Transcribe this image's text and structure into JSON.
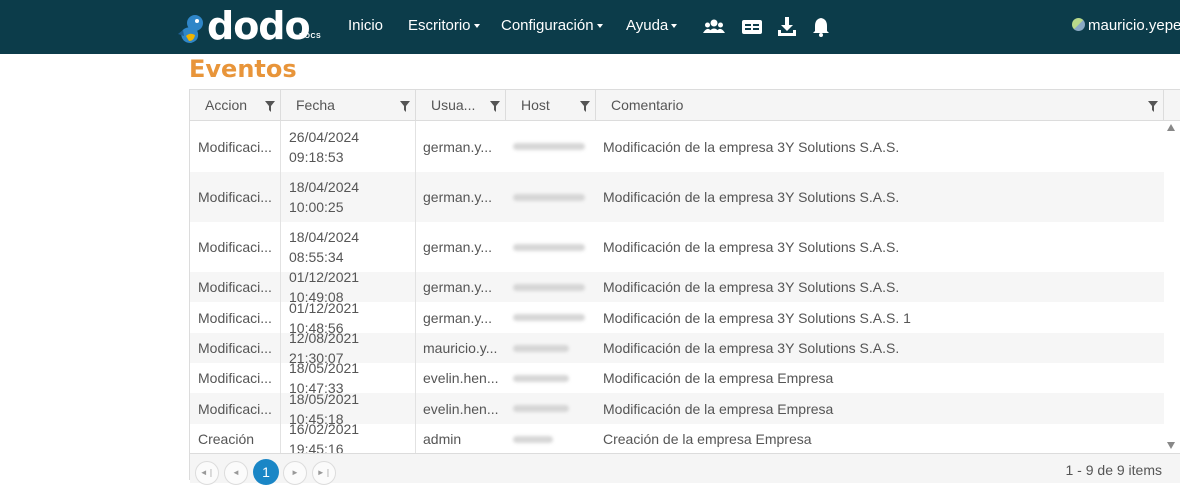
{
  "header": {
    "logo_text": "dodo",
    "logo_sub": "DOCS",
    "nav": [
      {
        "label": "Inicio"
      },
      {
        "label": "Escritorio"
      },
      {
        "label": "Configuración"
      },
      {
        "label": "Ayuda"
      }
    ],
    "icons": [
      "users-icon",
      "id-card-icon",
      "download-icon",
      "bell-icon"
    ],
    "user": "mauricio.yepe",
    "bar_color": "#0c3c4a"
  },
  "page": {
    "title": "Eventos",
    "title_color": "#e8953a"
  },
  "grid": {
    "columns": [
      "Accion",
      "Fecha",
      "Usua...",
      "Host",
      "Comentario"
    ],
    "rows": [
      {
        "accion": "Modificaci...",
        "fecha": "26/04/2024 09:18:53",
        "usuario": "german.y...",
        "comentario": "Modificación de la empresa 3Y Solutions S.A.S."
      },
      {
        "accion": "Modificaci...",
        "fecha": "18/04/2024 10:00:25",
        "usuario": "german.y...",
        "comentario": "Modificación de la empresa 3Y Solutions S.A.S."
      },
      {
        "accion": "Modificaci...",
        "fecha": "18/04/2024 08:55:34",
        "usuario": "german.y...",
        "comentario": "Modificación de la empresa 3Y Solutions S.A.S."
      },
      {
        "accion": "Modificaci...",
        "fecha": "01/12/2021 10:49:08",
        "usuario": "german.y...",
        "comentario": "Modificación de la empresa 3Y Solutions S.A.S."
      },
      {
        "accion": "Modificaci...",
        "fecha": "01/12/2021 10:48:56",
        "usuario": "german.y...",
        "comentario": "Modificación de la empresa 3Y Solutions S.A.S. 1"
      },
      {
        "accion": "Modificaci...",
        "fecha": "12/08/2021 21:30:07",
        "usuario": "mauricio.y...",
        "comentario": "Modificación de la empresa 3Y Solutions S.A.S."
      },
      {
        "accion": "Modificaci...",
        "fecha": "18/05/2021 10:47:33",
        "usuario": "evelin.hen...",
        "comentario": "Modificación de la empresa Empresa"
      },
      {
        "accion": "Modificaci...",
        "fecha": "18/05/2021 10:45:18",
        "usuario": "evelin.hen...",
        "comentario": "Modificación de la empresa Empresa"
      },
      {
        "accion": "Creación",
        "fecha": "16/02/2021 19:45:16",
        "usuario": "admin",
        "comentario": "Creación de la empresa Empresa"
      }
    ]
  },
  "pager": {
    "current_page": "1",
    "info": "1 - 9 de 9 items",
    "accent": "#1a86c6"
  }
}
